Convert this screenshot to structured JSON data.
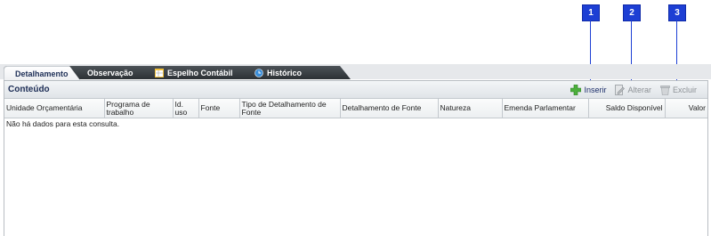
{
  "callouts": [
    "1",
    "2",
    "3"
  ],
  "tabs": [
    {
      "label": "Detalhamento",
      "active": true
    },
    {
      "label": "Observação",
      "active": false
    },
    {
      "label": "Espelho Contábil",
      "icon": "spreadsheet-icon",
      "active": false
    },
    {
      "label": "Histórico",
      "icon": "history-icon",
      "active": false
    }
  ],
  "panel": {
    "title": "Conteúdo",
    "actions": {
      "insert": "Inserir",
      "edit": "Alterar",
      "delete": "Excluir"
    }
  },
  "table": {
    "columns": [
      "Unidade Orçamentária",
      "Programa de trabalho",
      "Id. uso",
      "Fonte",
      "Tipo de Detalhamento de Fonte",
      "Detalhamento de Fonte",
      "Natureza",
      "Emenda Parlamentar",
      "Saldo Disponível",
      "Valor"
    ],
    "empty_message": "Não há dados para esta consulta."
  },
  "colors": {
    "callout": "#1d3fd4",
    "tab_dark": "#2c3135",
    "title": "#1c2d55"
  }
}
